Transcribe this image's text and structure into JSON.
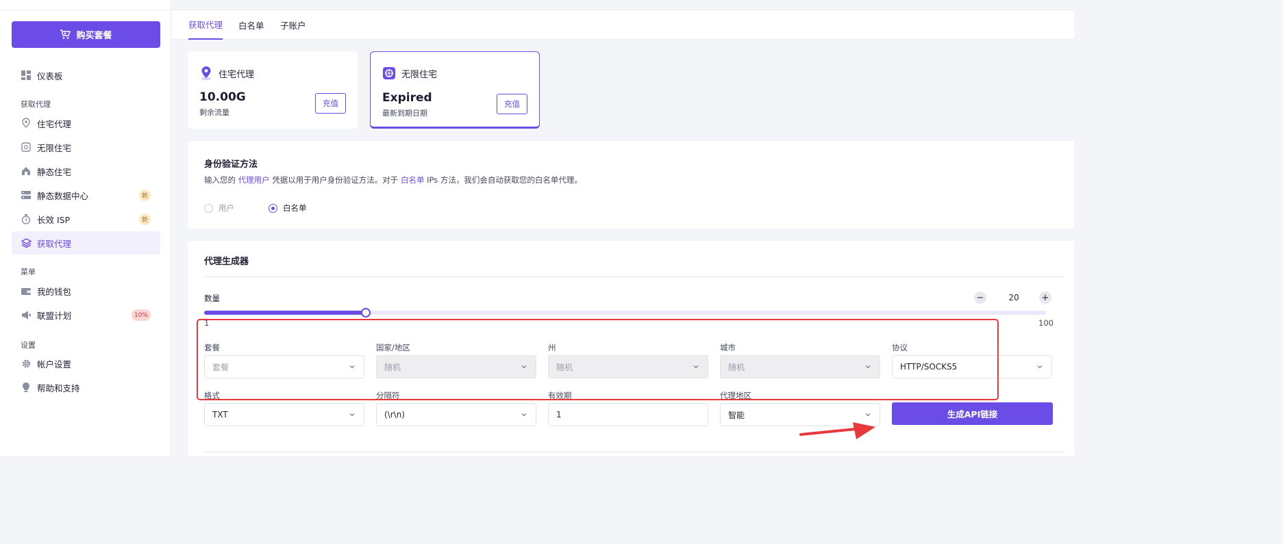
{
  "sidebar": {
    "buy_label": "购买套餐",
    "sections": {
      "get_proxy": "获取代理",
      "menu": "菜单",
      "settings": "设置"
    },
    "items": [
      {
        "label": "仪表板",
        "icon": "dashboard-icon"
      },
      {
        "label": "住宅代理",
        "icon": "location-pin-icon"
      },
      {
        "label": "无限住宅",
        "icon": "infinite-residential-icon"
      },
      {
        "label": "静态住宅",
        "icon": "home-icon"
      },
      {
        "label": "静态数据中心",
        "icon": "server-icon",
        "badge": "新"
      },
      {
        "label": "长效 ISP",
        "icon": "stopwatch-icon",
        "badge": "新"
      },
      {
        "label": "获取代理",
        "icon": "layers-icon",
        "active": true
      },
      {
        "label": "我的钱包",
        "icon": "wallet-icon"
      },
      {
        "label": "联盟计划",
        "icon": "megaphone-icon",
        "badge": "10%"
      },
      {
        "label": "帐户设置",
        "icon": "gear-icon"
      },
      {
        "label": "帮助和支持",
        "icon": "lightbulb-icon"
      }
    ]
  },
  "tabs": [
    {
      "label": "获取代理",
      "active": true
    },
    {
      "label": "白名单"
    },
    {
      "label": "子账户"
    }
  ],
  "products": [
    {
      "title": "住宅代理",
      "value": "10.00G",
      "sub": "剩余流量",
      "button": "充值",
      "selected": false,
      "icon": "location-pin-icon"
    },
    {
      "title": "无限住宅",
      "value": "Expired",
      "sub": "最新到期日期",
      "button": "充值",
      "selected": true,
      "icon": "infinite-residential-icon"
    }
  ],
  "auth": {
    "title": "身份验证方法",
    "desc_1": "输入您的",
    "desc_link_1": "代理用户",
    "desc_2": "凭据以用于用户身份验证方法。对于",
    "desc_link_2": "白名单",
    "desc_3": "IPs 方法，我们会自动获取您的白名单代理。",
    "options": [
      {
        "label": "用户",
        "selected": false
      },
      {
        "label": "白名单",
        "selected": true
      }
    ]
  },
  "generator": {
    "title": "代理生成器",
    "quantity_label": "数量",
    "quantity": 20,
    "min": 1,
    "max": 100,
    "minus": "−",
    "plus": "+",
    "fields": {
      "package": {
        "label": "套餐",
        "value": "套餐",
        "placeholder": true
      },
      "country": {
        "label": "国家/地区",
        "value": "随机",
        "disabled": true
      },
      "state": {
        "label": "州",
        "value": "随机",
        "disabled": true
      },
      "city": {
        "label": "城市",
        "value": "随机",
        "disabled": true
      },
      "protocol": {
        "label": "协议",
        "value": "HTTP/SOCKS5"
      },
      "format": {
        "label": "格式",
        "value": "TXT"
      },
      "separator": {
        "label": "分隔符",
        "value": "(\\r\\n)"
      },
      "validity": {
        "label": "有效期",
        "value": "1"
      },
      "region": {
        "label": "代理地区",
        "value": "智能"
      }
    },
    "generate_label": "生成API链接"
  },
  "colors": {
    "accent": "#6b4ce6",
    "annotation": "#e8383d"
  }
}
